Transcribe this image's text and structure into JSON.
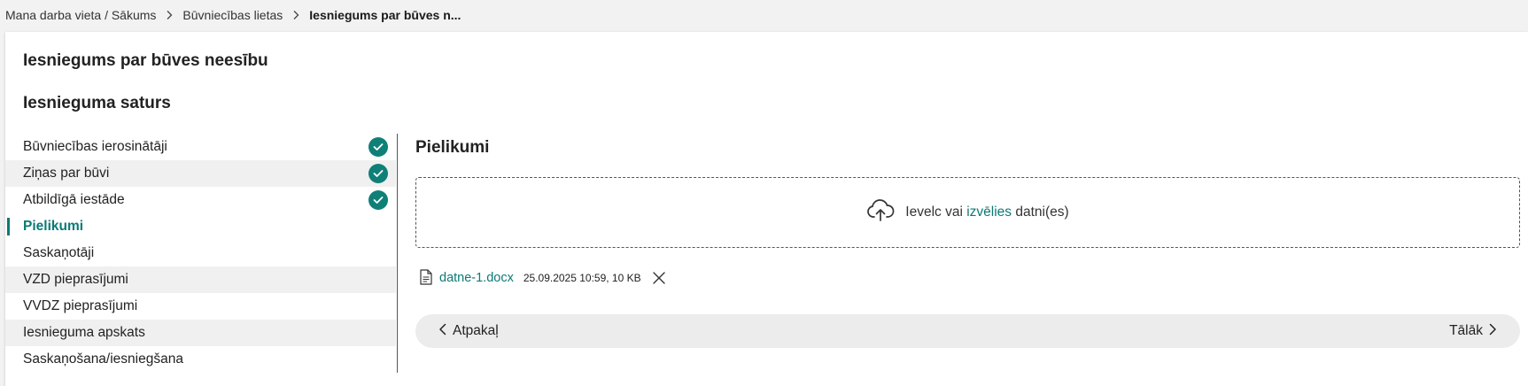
{
  "breadcrumb": {
    "items": [
      "Mana darba vieta / Sākums",
      "Būvniecības lietas"
    ],
    "current": "Iesniegums par būves n..."
  },
  "page": {
    "title": "Iesniegums par būves neesību",
    "section_title": "Iesnieguma saturs"
  },
  "steps": [
    {
      "label": "Būvniecības ierosinātāji",
      "completed": true
    },
    {
      "label": "Ziņas par būvi",
      "completed": true
    },
    {
      "label": "Atbildīgā iestāde",
      "completed": true
    },
    {
      "label": "Pielikumi",
      "active": true
    },
    {
      "label": "Saskaņotāji"
    },
    {
      "label": "VZD pieprasījumi"
    },
    {
      "label": "VVDZ pieprasījumi"
    },
    {
      "label": "Iesnieguma apskats"
    },
    {
      "label": "Saskaņošana/iesniegšana"
    }
  ],
  "attachments": {
    "title": "Pielikumi",
    "dropzone": {
      "prefix": "Ievelc vai",
      "link": "izvēlies",
      "suffix": "datni(es)"
    },
    "files": [
      {
        "name": "datne-1.docx",
        "meta": "25.09.2025 10:59, 10 KB"
      }
    ]
  },
  "navigation": {
    "back_label": "Atpakaļ",
    "next_label": "Tālāk"
  },
  "colors": {
    "accent": "#0b7a75",
    "check": "#0f8078"
  },
  "icons": {
    "step_done": "check-circle-icon",
    "upload": "cloud-upload-icon",
    "file": "document-icon",
    "remove": "close-icon"
  }
}
